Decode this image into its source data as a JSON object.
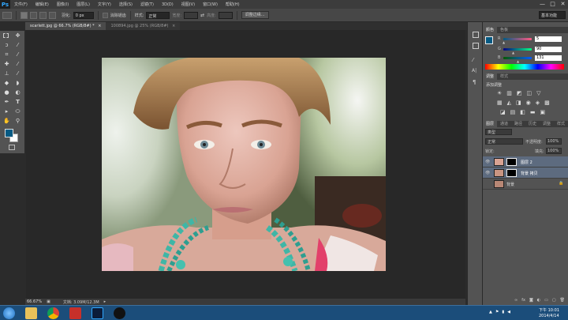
{
  "app": {
    "logo": "Ps"
  },
  "menu": [
    "文件(F)",
    "编辑(E)",
    "图像(I)",
    "图层(L)",
    "文字(Y)",
    "选择(S)",
    "滤镜(T)",
    "3D(D)",
    "视图(V)",
    "窗口(W)",
    "帮助(H)"
  ],
  "window_controls": {
    "minimize": "—",
    "restore": "□",
    "close": "✕"
  },
  "options": {
    "feather_label": "羽化:",
    "feather_value": "0 px",
    "antialias_label": "消除锯齿",
    "style_label": "样式:",
    "style_value": "正常",
    "width_label": "宽度:",
    "height_label": "高度:",
    "refine_button": "调整边缘...",
    "workspace": "基本功能"
  },
  "tabs": [
    {
      "label": "scarlett.jpg @ 66.7% (RGB/8#) *",
      "close": "×"
    },
    {
      "label": "100894.jpg @ 25% (RGB/8#)",
      "close": "×"
    }
  ],
  "status": {
    "zoom": "66.67%",
    "doc": "文档: 3.09M/12.3M"
  },
  "color_panel": {
    "tabs": [
      "颜色",
      "色板"
    ],
    "r_label": "R",
    "r_value": "5",
    "g_label": "G",
    "g_value": "90",
    "b_label": "B",
    "b_value": "131",
    "r_fraction": 0.02,
    "g_fraction": 0.35,
    "b_fraction": 0.51,
    "foreground": "#055a83"
  },
  "adjust_panel": {
    "tabs": [
      "调整",
      "样式"
    ],
    "title": "添加调整"
  },
  "layers_panel": {
    "tabs": [
      "图层",
      "通道",
      "路径",
      "历史",
      "调整",
      "样式"
    ],
    "kind_label": "类型",
    "blend_mode": "正常",
    "opacity_label": "不透明度:",
    "opacity_value": "100%",
    "lock_label": "锁定:",
    "fill_label": "填充:",
    "fill_value": "100%",
    "layers": [
      {
        "name": "图层 2"
      },
      {
        "name": "背景 拷贝"
      },
      {
        "name": "背景"
      }
    ]
  },
  "taskbar": {
    "time": "下午 10:01",
    "date": "2014/4/14"
  }
}
